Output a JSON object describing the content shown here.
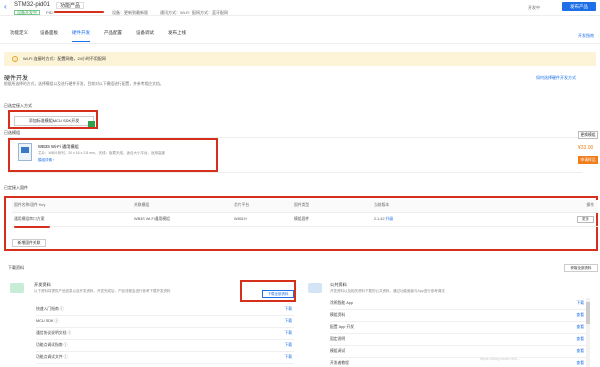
{
  "header": {
    "title": "STM32-pid01",
    "product_dropdown": "功能产品",
    "status": "设备开发中",
    "pid_label": "PID:",
    "meta_items": [
      "设备：更新到最新版",
      "通讯方式：Wi-Fi",
      "配网方式：蓝牙配网"
    ],
    "dev_mode": "开发中",
    "publish_label": "发布产品"
  },
  "tabs": [
    {
      "label": "功能定义",
      "active": false
    },
    {
      "label": "设备面板",
      "active": false
    },
    {
      "label": "硬件开发",
      "active": true
    },
    {
      "label": "产品配置",
      "active": false
    },
    {
      "label": "设备调试",
      "active": false
    },
    {
      "label": "发布上线",
      "active": false
    }
  ],
  "guide_link": "开发指南",
  "banner": {
    "text": "Wi-Fi 连接时方式：配置网络，24小时不用配网"
  },
  "section_title": "硬件开发",
  "section_desc": "根据所选择的方式，选择模组以及进行硬件开发，目前对以下模组进行配置，并参考相应文档。",
  "top_link": "如何选择硬件开发方式",
  "access_label": "已选定接入方式",
  "access_option": "添加标准模组MCU SDK开发",
  "module_label": "已选模组",
  "module": {
    "name": "WB3S Wi-Fi 通用模组",
    "spec": "芯片：W801系列，20 x 16 x 2.8 mm，天线：板载天线，适合大小平台，适用高度",
    "link": "模组详情 ›",
    "change_btn": "更换模组",
    "price": "¥33.00",
    "buy_btn": "申请样品"
  },
  "firmware_label": "已定接入固件",
  "table": {
    "headers": [
      "固件名称/固件 Key",
      "关联模组",
      "芯片平台",
      "固件类型",
      "当前版本",
      "操作"
    ],
    "rows": [
      [
        "通用模组串口方案",
        "WB3S Wi-Fi通用模组",
        "W801H",
        "模组固件",
        "2.1.42",
        "更多"
      ]
    ],
    "version_link": "升级"
  },
  "add_firmware": "新增固件关联",
  "downloads": {
    "title": "下载资料",
    "download_all": "获取全部资料",
    "dev_panel": {
      "title": "开发资料",
      "desc": "以下资料将提供产品信息以及开发资料，开发完成后，产品流程会进行参考下载开发资料",
      "download_btn": "下载全部资料",
      "items": [
        {
          "name": "快速入门指南 ⓘ",
          "action": "下载"
        },
        {
          "name": "MCU SDK ⓘ",
          "action": "下载"
        },
        {
          "name": "通信协议说明文档 ⓘ",
          "action": "下载"
        },
        {
          "name": "功能点调试指南 ⓘ",
          "action": "下载"
        },
        {
          "name": "功能点调试文件 ⓘ",
          "action": "下载"
        }
      ]
    },
    "public_panel": {
      "title": "公共资料",
      "desc": "开发资料以及相关资料下载的公共资料，通过功能面板与App进行参考调试",
      "items": [
        {
          "name": "涂鸦智能 App",
          "action": "下载"
        },
        {
          "name": "模组资料",
          "action": "查看"
        },
        {
          "name": "配置 App 开发",
          "action": "查看"
        },
        {
          "name": "固定说明",
          "action": "查看"
        },
        {
          "name": "模组调试",
          "action": "查看"
        },
        {
          "name": "开发者教程",
          "action": "查看"
        }
      ]
    }
  },
  "watermark": "https://blog.csdn.net/..."
}
